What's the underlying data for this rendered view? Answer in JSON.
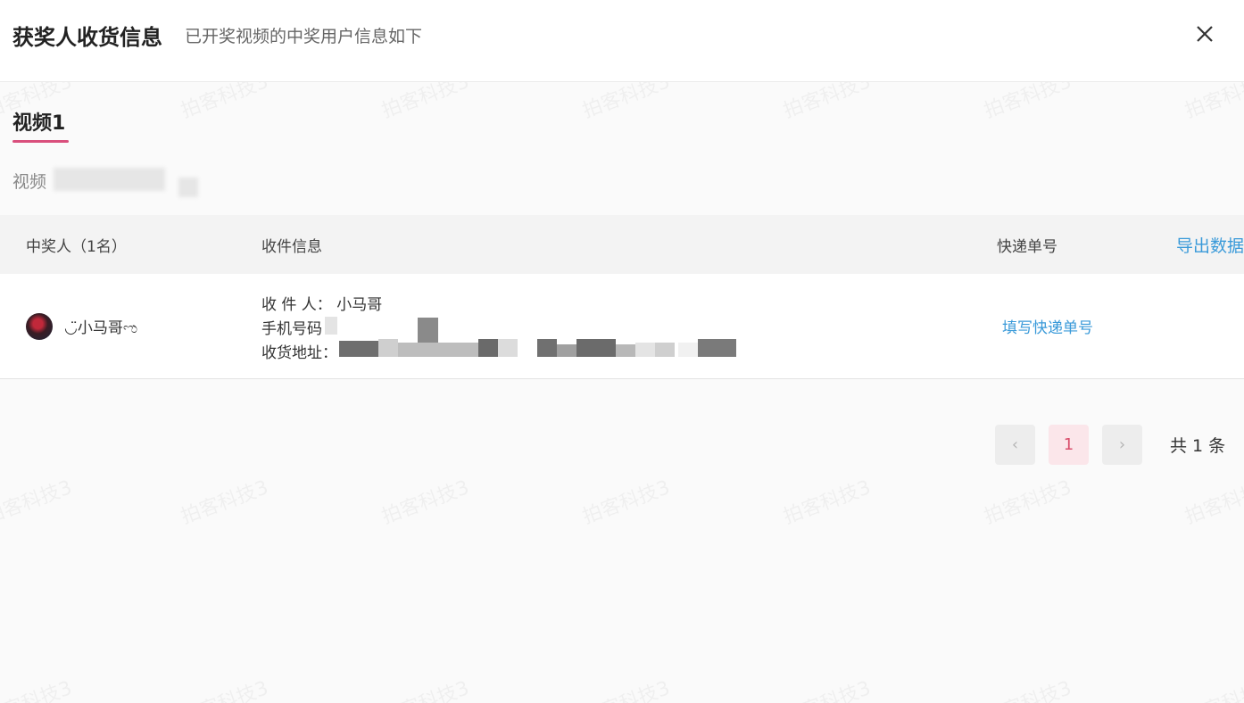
{
  "header": {
    "title": "获奖人收货信息",
    "subtitle": "已开奖视频的中奖用户信息如下"
  },
  "tab": {
    "label": "视频1"
  },
  "video": {
    "label": "视频"
  },
  "table": {
    "columns": [
      "中奖人（1名）",
      "收件信息",
      "快递单号"
    ],
    "export_label": "导出数据",
    "rows": [
      {
        "nickname": "◡̈小马哥ಌ",
        "recipient": "收 件 人： 小马哥",
        "phone_label": "手机号码",
        "address_label": "收货地址：",
        "action": "填写快递单号"
      }
    ]
  },
  "pagination": {
    "current_page": "1",
    "total": "共 1 条"
  },
  "watermark": "拍客科技3"
}
